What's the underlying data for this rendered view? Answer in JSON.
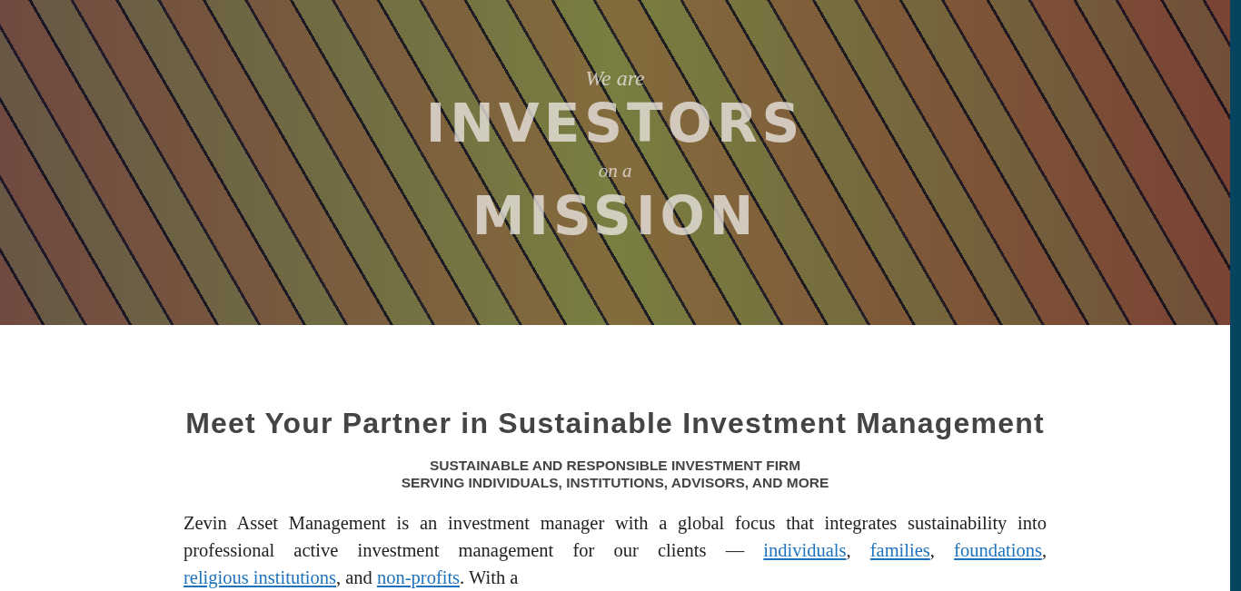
{
  "hero": {
    "intro": "We are",
    "headline_1": "INVESTORS",
    "connector": "on a",
    "headline_2": "MISSION"
  },
  "section": {
    "heading": "Meet Your Partner in Sustainable Investment Management",
    "subheading": [
      "SUSTAINABLE AND RESPONSIBLE INVESTMENT FIRM",
      "SERVING INDIVIDUALS, INSTITUTIONS, ADVISORS, AND MORE"
    ],
    "paragraph": [
      {
        "kind": "text",
        "text": "Zevin Asset Management is an investment manager with a global focus that integrates sustainability into professional active investment management for our clients — "
      },
      {
        "kind": "link",
        "text": "individuals"
      },
      {
        "kind": "text",
        "text": ", "
      },
      {
        "kind": "link",
        "text": "families"
      },
      {
        "kind": "text",
        "text": ", "
      },
      {
        "kind": "link",
        "text": "foundations"
      },
      {
        "kind": "text",
        "text": ", "
      },
      {
        "kind": "link",
        "text": "religious institutions"
      },
      {
        "kind": "text",
        "text": ", and "
      },
      {
        "kind": "link",
        "text": "non-profits"
      },
      {
        "kind": "text",
        "text": ". With a"
      }
    ]
  }
}
